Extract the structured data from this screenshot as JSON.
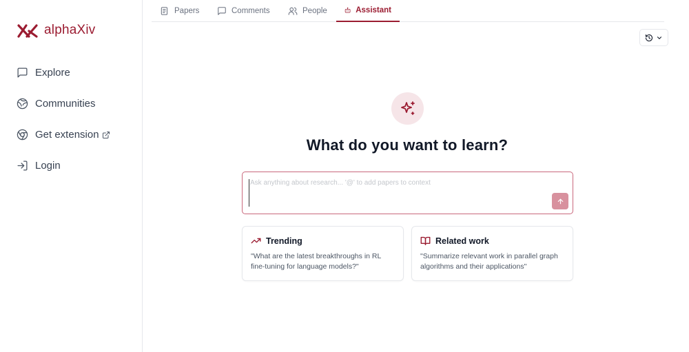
{
  "brand": {
    "name": "alphaXiv",
    "color": "#9b1c31"
  },
  "sidebar": {
    "items": [
      {
        "label": "Explore",
        "icon": "message-square-icon"
      },
      {
        "label": "Communities",
        "icon": "globe-icon"
      },
      {
        "label": "Get extension",
        "icon": "chrome-icon"
      },
      {
        "label": "Login",
        "icon": "login-icon"
      }
    ]
  },
  "tabs": [
    {
      "label": "Papers",
      "icon": "papers-icon",
      "active": false
    },
    {
      "label": "Comments",
      "icon": "comment-icon",
      "active": false
    },
    {
      "label": "People",
      "icon": "users-icon",
      "active": false
    },
    {
      "label": "Assistant",
      "icon": "bot-icon",
      "active": true
    }
  ],
  "assistant": {
    "headline": "What do you want to learn?",
    "input_placeholder": "Ask anything about research... '@' to add papers to context",
    "input_value": ""
  },
  "suggestions": [
    {
      "title": "Trending",
      "icon": "trending-up-icon",
      "text": "\"What are the latest breakthroughs in RL fine-tuning for language models?\""
    },
    {
      "title": "Related work",
      "icon": "book-open-icon",
      "text": "\"Summarize relevant work in parallel graph algorithms and their applications\""
    }
  ]
}
